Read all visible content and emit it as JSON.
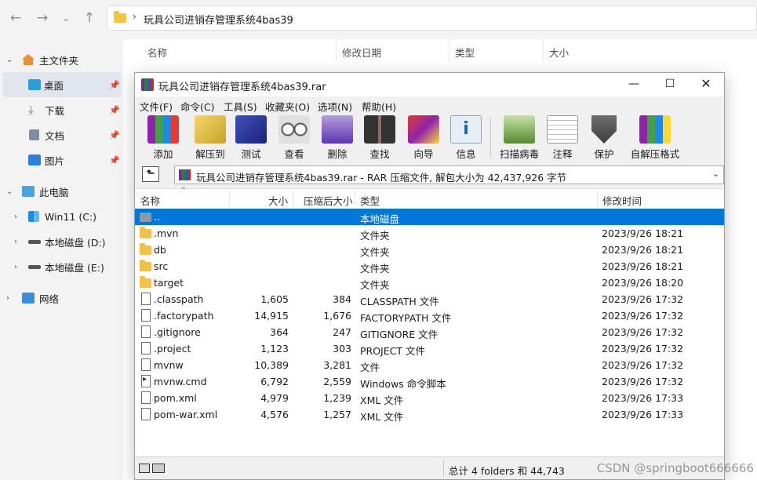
{
  "explorer": {
    "path": "玩具公司进销存管理系统4bas39",
    "sidebar": [
      {
        "label": "主文件夹",
        "icon": "home-icon",
        "chevron": "⌄"
      },
      {
        "label": "桌面",
        "icon": "desktop-icon",
        "pinned": true,
        "selected": true
      },
      {
        "label": "下载",
        "icon": "download-icon",
        "pinned": true
      },
      {
        "label": "文档",
        "icon": "document-icon",
        "pinned": true
      },
      {
        "label": "图片",
        "icon": "picture-icon",
        "pinned": true
      },
      {
        "label": "此电脑",
        "icon": "pc-icon",
        "chevron": "⌄"
      },
      {
        "label": "Win11 (C:)",
        "icon": "windows-drive-icon",
        "chevron": "›"
      },
      {
        "label": "本地磁盘 (D:)",
        "icon": "drive-icon",
        "chevron": "›"
      },
      {
        "label": "本地磁盘 (E:)",
        "icon": "drive-icon",
        "chevron": "›"
      },
      {
        "label": "网络",
        "icon": "network-icon",
        "chevron": "›"
      }
    ],
    "columns": [
      "名称",
      "修改日期",
      "类型",
      "大小"
    ]
  },
  "rar": {
    "title": "玩具公司进销存管理系统4bas39.rar",
    "menus": [
      "文件(F)",
      "命令(C)",
      "工具(S)",
      "收藏夹(O)",
      "选项(N)",
      "帮助(H)"
    ],
    "toolbar": [
      "添加",
      "解压到",
      "测试",
      "查看",
      "删除",
      "查找",
      "向导",
      "信息",
      "扫描病毒",
      "注释",
      "保护",
      "自解压格式"
    ],
    "archive_info": "玩具公司进销存管理系统4bas39.rar - RAR 压缩文件, 解包大小为 42,437,926 字节",
    "columns": [
      "名称",
      "大小",
      "压缩后大小",
      "类型",
      "修改时间"
    ],
    "rows": [
      {
        "name": "..",
        "size": "",
        "packed": "",
        "type": "本地磁盘",
        "mtime": "",
        "kind": "drive"
      },
      {
        "name": ".mvn",
        "size": "",
        "packed": "",
        "type": "文件夹",
        "mtime": "2023/9/26 18:21",
        "kind": "folder"
      },
      {
        "name": "db",
        "size": "",
        "packed": "",
        "type": "文件夹",
        "mtime": "2023/9/26 18:21",
        "kind": "folder"
      },
      {
        "name": "src",
        "size": "",
        "packed": "",
        "type": "文件夹",
        "mtime": "2023/9/26 18:21",
        "kind": "folder"
      },
      {
        "name": "target",
        "size": "",
        "packed": "",
        "type": "文件夹",
        "mtime": "2023/9/26 18:20",
        "kind": "folder"
      },
      {
        "name": ".classpath",
        "size": "1,605",
        "packed": "384",
        "type": "CLASSPATH 文件",
        "mtime": "2023/9/26 17:32",
        "kind": "file"
      },
      {
        "name": ".factorypath",
        "size": "14,915",
        "packed": "1,676",
        "type": "FACTORYPATH 文件",
        "mtime": "2023/9/26 17:32",
        "kind": "file"
      },
      {
        "name": ".gitignore",
        "size": "364",
        "packed": "247",
        "type": "GITIGNORE 文件",
        "mtime": "2023/9/26 17:32",
        "kind": "file"
      },
      {
        "name": ".project",
        "size": "1,123",
        "packed": "303",
        "type": "PROJECT 文件",
        "mtime": "2023/9/26 17:32",
        "kind": "file"
      },
      {
        "name": "mvnw",
        "size": "10,389",
        "packed": "3,281",
        "type": "文件",
        "mtime": "2023/9/26 17:32",
        "kind": "file"
      },
      {
        "name": "mvnw.cmd",
        "size": "6,792",
        "packed": "2,559",
        "type": "Windows 命令脚本",
        "mtime": "2023/9/26 17:32",
        "kind": "cmd"
      },
      {
        "name": "pom.xml",
        "size": "4,979",
        "packed": "1,239",
        "type": "XML 文件",
        "mtime": "2023/9/26 17:33",
        "kind": "file"
      },
      {
        "name": "pom-war.xml",
        "size": "4,576",
        "packed": "1,257",
        "type": "XML 文件",
        "mtime": "2023/9/26 17:33",
        "kind": "file"
      }
    ],
    "status": "总计 4 folders 和 44,743"
  },
  "watermark": "CSDN @springboot666666"
}
